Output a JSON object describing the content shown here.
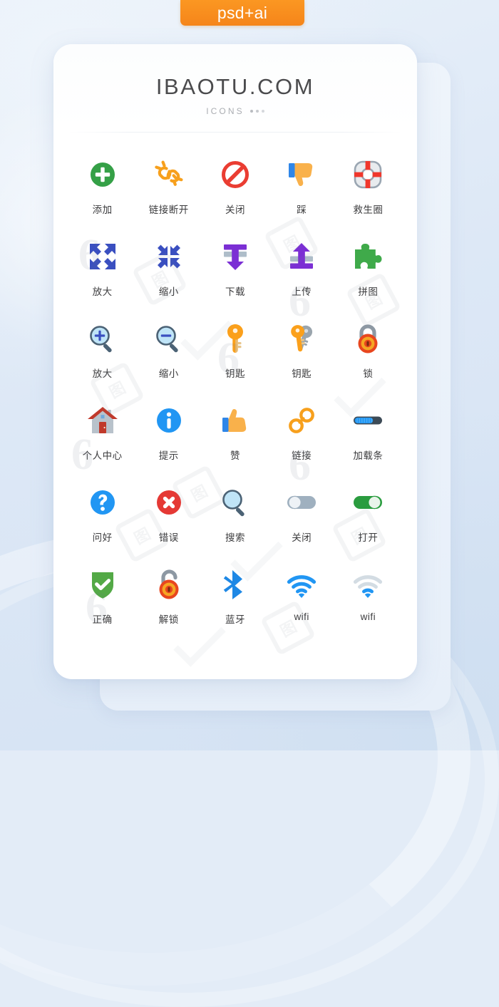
{
  "badge": {
    "label": "psd+ai",
    "color": "#f5851a"
  },
  "card": {
    "title": "IBAOTU.COM",
    "subtitle": "ICONS",
    "dots_count": 3
  },
  "grid": {
    "columns": 5,
    "items": [
      {
        "label": "添加",
        "icon": "add-circle-icon",
        "colors": {
          "primary": "#35a047",
          "secondary": "#ffffff"
        }
      },
      {
        "label": "链接断开",
        "icon": "broken-link-icon",
        "colors": {
          "primary": "#f7a01d",
          "secondary": "#f7a01d"
        }
      },
      {
        "label": "关闭",
        "icon": "prohibition-icon",
        "colors": {
          "primary": "#ea3d32",
          "secondary": "#ffffff"
        }
      },
      {
        "label": "踩",
        "icon": "thumbs-down-icon",
        "colors": {
          "primary": "#f9b council",
          "secondary": "#2f86e8"
        }
      },
      {
        "label": "救生圈",
        "icon": "lifebuoy-icon",
        "colors": {
          "primary": "#e8ebee",
          "secondary": "#f0372c"
        }
      },
      {
        "label": "放大",
        "icon": "expand-arrows-icon",
        "colors": {
          "primary": "#3a4fc0",
          "secondary": "#3a4fc0"
        }
      },
      {
        "label": "缩小",
        "icon": "collapse-arrows-icon",
        "colors": {
          "primary": "#3a4fc0",
          "secondary": "#3a4fc0"
        }
      },
      {
        "label": "下载",
        "icon": "download-icon",
        "colors": {
          "primary": "#7b2fd4",
          "secondary": "#aebdc9"
        }
      },
      {
        "label": "上传",
        "icon": "upload-icon",
        "colors": {
          "primary": "#7b2fd4",
          "secondary": "#aebdc9"
        }
      },
      {
        "label": "拼图",
        "icon": "puzzle-piece-icon",
        "colors": {
          "primary": "#3faa4a",
          "secondary": "#3faa4a"
        }
      },
      {
        "label": "放大",
        "icon": "zoom-in-icon",
        "colors": {
          "primary": "#bfe4f7",
          "secondary": "#4b6275"
        }
      },
      {
        "label": "缩小",
        "icon": "zoom-out-icon",
        "colors": {
          "primary": "#bfe4f7",
          "secondary": "#4b6275"
        }
      },
      {
        "label": "钥匙",
        "icon": "key-icon",
        "colors": {
          "primary": "#fba01b",
          "secondary": "#e8c58a"
        }
      },
      {
        "label": "钥匙",
        "icon": "two-keys-icon",
        "colors": {
          "primary": "#fba01b",
          "secondary": "#9aa5ad"
        }
      },
      {
        "label": "锁",
        "icon": "lock-closed-icon",
        "colors": {
          "primary": "#e8461e",
          "secondary": "#8d98a3"
        }
      },
      {
        "label": "个人中心",
        "icon": "home-icon",
        "colors": {
          "primary": "#c0392b",
          "secondary": "#b8c2cb"
        }
      },
      {
        "label": "提示",
        "icon": "info-circle-icon",
        "colors": {
          "primary": "#2196f3",
          "secondary": "#ffffff"
        }
      },
      {
        "label": "赞",
        "icon": "thumbs-up-icon",
        "colors": {
          "primary": "#f9b councilb",
          "secondary": "#2f86e8"
        }
      },
      {
        "label": "链接",
        "icon": "chain-link-icon",
        "colors": {
          "primary": "#f7a01d",
          "secondary": "#f7a01d"
        }
      },
      {
        "label": "加载条",
        "icon": "loading-bar-icon",
        "colors": {
          "primary": "#2196f3",
          "secondary": "#3c4a56"
        }
      },
      {
        "label": "问好",
        "icon": "question-circle-icon",
        "colors": {
          "primary": "#2196f3",
          "secondary": "#ffffff"
        }
      },
      {
        "label": "错误",
        "icon": "error-circle-icon",
        "colors": {
          "primary": "#e53935",
          "secondary": "#ffffff"
        }
      },
      {
        "label": "搜索",
        "icon": "search-icon",
        "colors": {
          "primary": "#bfe4f7",
          "secondary": "#4b6275"
        }
      },
      {
        "label": "关闭",
        "icon": "toggle-off-icon",
        "colors": {
          "primary": "#9fb0bf",
          "secondary": "#eef2f6"
        }
      },
      {
        "label": "打开",
        "icon": "toggle-on-icon",
        "colors": {
          "primary": "#2a9c3f",
          "secondary": "#e9f4ea"
        }
      },
      {
        "label": "正确",
        "icon": "shield-check-icon",
        "colors": {
          "primary": "#53a946",
          "secondary": "#ffffff"
        }
      },
      {
        "label": "解锁",
        "icon": "lock-open-icon",
        "colors": {
          "primary": "#e8461e",
          "secondary": "#8d98a3"
        }
      },
      {
        "label": "蓝牙",
        "icon": "bluetooth-icon",
        "colors": {
          "primary": "#1e88e5",
          "secondary": "#1e88e5"
        }
      },
      {
        "label": "wifi",
        "icon": "wifi-full-icon",
        "colors": {
          "primary": "#2196f3",
          "secondary": "#2196f3"
        }
      },
      {
        "label": "wifi",
        "icon": "wifi-weak-icon",
        "colors": {
          "primary": "#2196f3",
          "secondary": "#d3dce3"
        }
      }
    ]
  },
  "watermarks": {
    "text_logo": "6",
    "box_text": "图"
  }
}
